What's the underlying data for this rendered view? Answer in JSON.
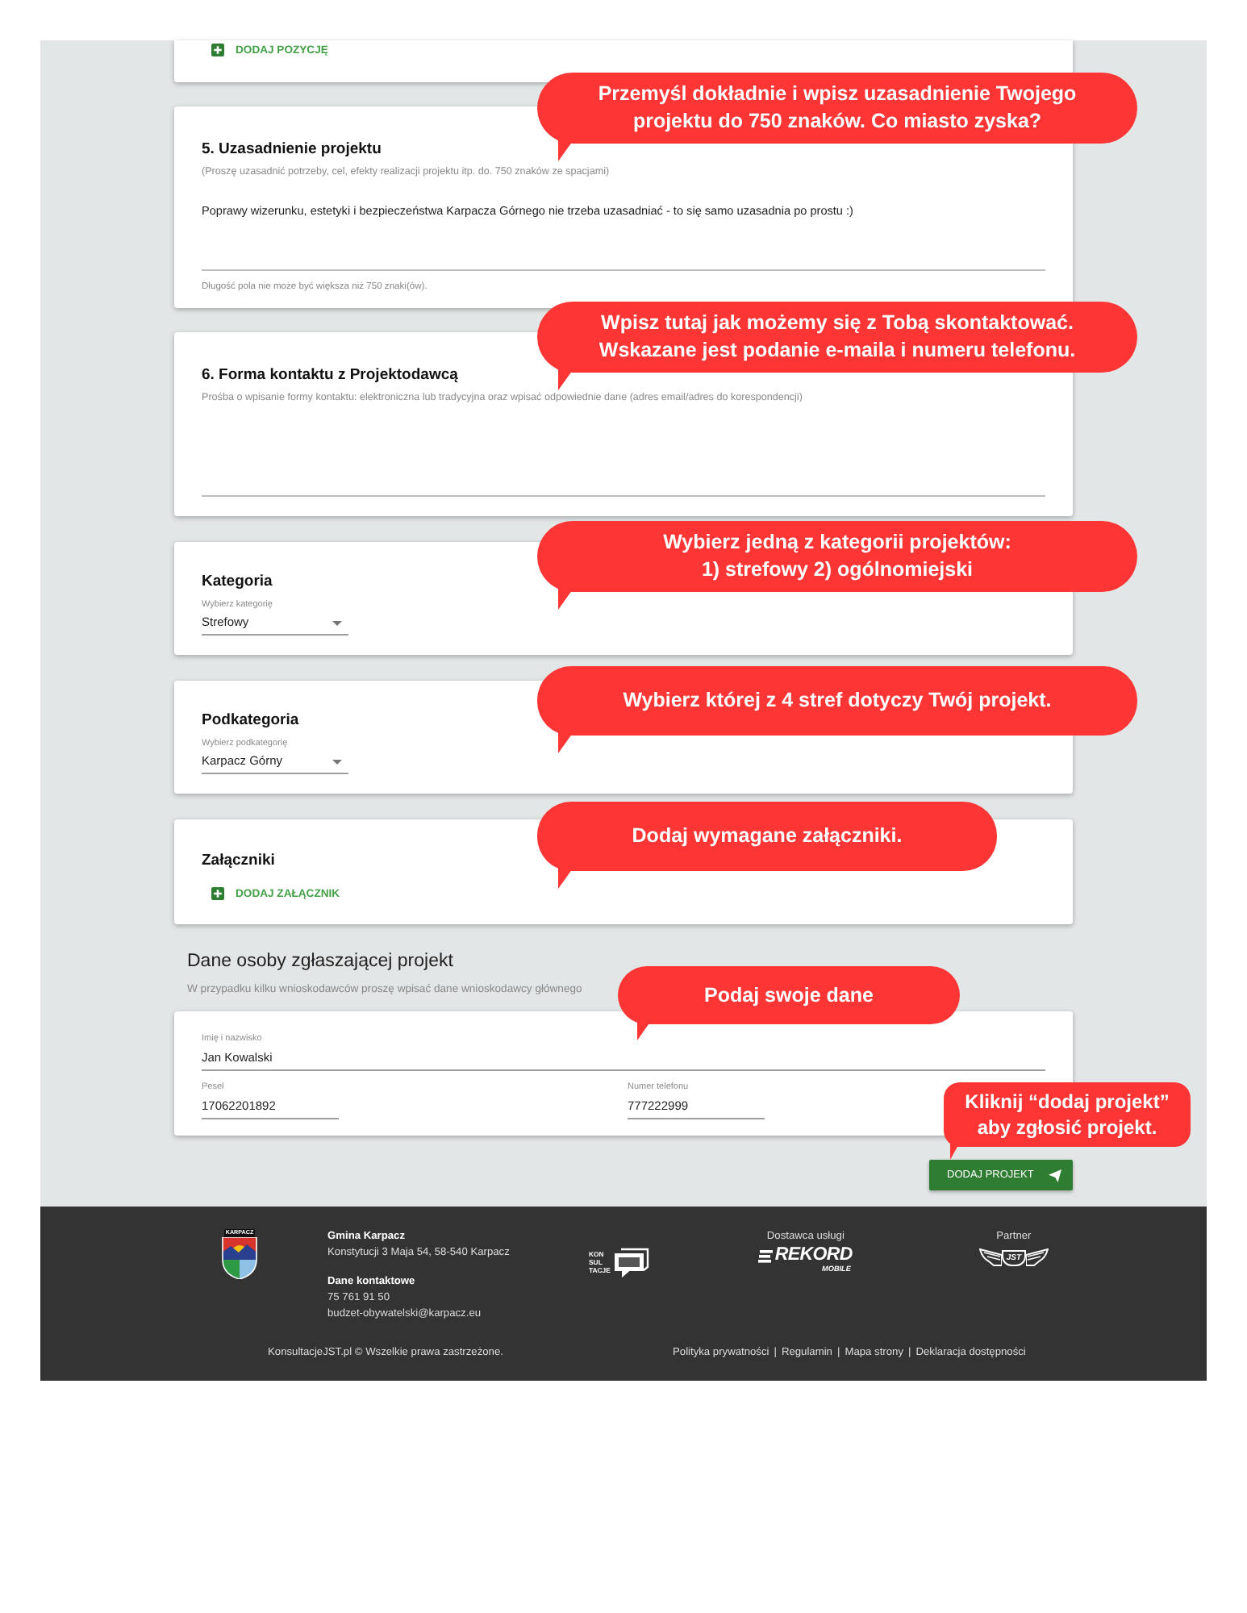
{
  "top_card": {
    "add_button": "DODAJ POZYCJĘ"
  },
  "sections": [
    {
      "kind": "textarea",
      "title": "5. Uzasadnienie projektu",
      "description": "(Proszę uzasadnić potrzeby, cel, efekty realizacji projektu itp. do. 750 znaków ze spacjami)",
      "value": "Poprawy wizerunku, estetyki i bezpieczeństwa Karpacza Górnego nie trzeba uzasadniać - to się samo uzasadnia po prostu :)",
      "counter": "Długość pola nie może być większa niż 750 znaki(ów).",
      "callout": "Przemyśl dokładnie i wpisz uzasadnienie Twojego\nprojektu do 750 znaków. Co miasto zyska?"
    },
    {
      "kind": "textarea",
      "title": "6. Forma kontaktu z Projektodawcą",
      "description": "Prośba o wpisanie formy kontaktu: elektroniczna lub tradycyjna oraz wpisać odpowiednie dane (adres email/adres do korespondencji)",
      "callout": "Wpisz tutaj jak możemy się z Tobą skontaktować.\nWskazane jest podanie e-maila i numeru telefonu."
    },
    {
      "kind": "select",
      "title": "Kategoria",
      "label": "Wybierz kategorię",
      "value": "Strefowy",
      "callout": "Wybierz jedną z kategorii projektów:\n1) strefowy 2) ogólnomiejski"
    },
    {
      "kind": "select",
      "title": "Podkategoria",
      "label": "Wybierz podkategorię",
      "value": "Karpacz Górny",
      "callout": "Wybierz której z 4 stref dotyczy Twój projekt."
    },
    {
      "kind": "attachments",
      "title": "Załączniki",
      "add_button": "DODAJ ZAŁĄCZNIK",
      "callout": "Dodaj wymagane załączniki."
    }
  ],
  "applicant": {
    "title": "Dane osoby zgłaszającej projekt",
    "subtitle": "W przypadku kilku wnioskodawców proszę wpisać dane wnioskodawcy głównego",
    "callout": "Podaj swoje dane",
    "fields": [
      {
        "kind": "wide",
        "label": "Imię i nazwisko",
        "value": "Jan Kowalski"
      },
      {
        "kind": "short",
        "label": "Pesel",
        "value": "17062201892"
      },
      {
        "kind": "short",
        "label": "Numer telefonu",
        "value": "777222999"
      }
    ]
  },
  "submit": {
    "label": "DODAJ PROJEKT",
    "callout": "Kliknij “dodaj projekt”\naby zgłosić projekt."
  },
  "footer": {
    "coat_of_arms": {
      "text": "KARPACZ"
    },
    "address": {
      "title": "Gmina Karpacz",
      "line": "Konstytucji 3 Maja 54, 58-540 Karpacz"
    },
    "contact": {
      "title": "Dane kontaktowe",
      "phone": "75 761 91 50",
      "email": "budzet-obywatelski@karpacz.eu"
    },
    "konsultacje_logo": {
      "lines": [
        "KON",
        "SUL",
        "TACJE"
      ]
    },
    "provider": {
      "label": "Dostawca usługi",
      "logo": "REKORD",
      "logo_subtext": "MOBILE"
    },
    "partner": {
      "label": "Partner",
      "logo": "JST"
    },
    "copyright": "KonsultacjeJST.pl © Wszelkie prawa zastrzeżone.",
    "links": [
      {
        "label": "Polityka prywatności",
        "separator": "|"
      },
      {
        "label": "Regulamin",
        "separator": "|"
      },
      {
        "label": "Mapa strony",
        "separator": "|"
      },
      {
        "label": "Deklaracja dostępności"
      }
    ]
  }
}
